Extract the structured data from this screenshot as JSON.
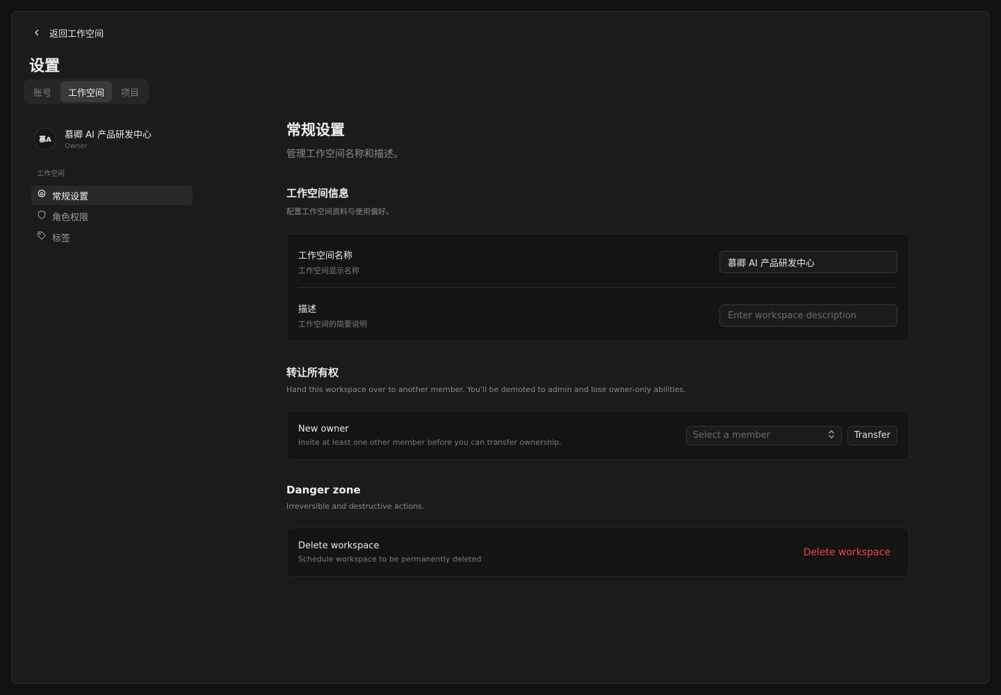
{
  "back": {
    "label": "返回工作空间"
  },
  "page_title": "设置",
  "tabs": [
    {
      "label": "账号"
    },
    {
      "label": "工作空间"
    },
    {
      "label": "项目"
    }
  ],
  "workspace": {
    "avatar_text": "慕A",
    "name": "慕卿 AI 产品研发中心",
    "role": "Owner"
  },
  "sidebar": {
    "group_label": "工作空间",
    "items": [
      {
        "label": "常规设置",
        "icon": "gear-icon"
      },
      {
        "label": "角色权限",
        "icon": "shield-icon"
      },
      {
        "label": "标签",
        "icon": "tag-icon"
      }
    ]
  },
  "main": {
    "title": "常规设置",
    "subtitle": "管理工作空间名称和描述。",
    "info": {
      "title": "工作空间信息",
      "desc": "配置工作空间资料与使用偏好。",
      "name_label": "工作空间名称",
      "name_hint": "工作空间显示名称",
      "name_value": "慕卿 AI 产品研发中心",
      "desc_label": "描述",
      "desc_hint": "工作空间的简要说明",
      "desc_placeholder": "Enter workspace description"
    },
    "transfer": {
      "title": "转让所有权",
      "desc": "Hand this workspace over to another member. You'll be demoted to admin and lose owner-only abilities.",
      "label": "New owner",
      "hint": "Invite at least one other member before you can transfer ownership.",
      "select_placeholder": "Select a member",
      "button": "Transfer"
    },
    "danger": {
      "title": "Danger zone",
      "desc": "Irreversible and destructive actions.",
      "label": "Delete workspace",
      "hint": "Schedule workspace to be permanently deleted",
      "button": "Delete workspace"
    }
  },
  "colors": {
    "background": "#1b1b1b",
    "card": "#141414",
    "danger": "#f24545"
  }
}
